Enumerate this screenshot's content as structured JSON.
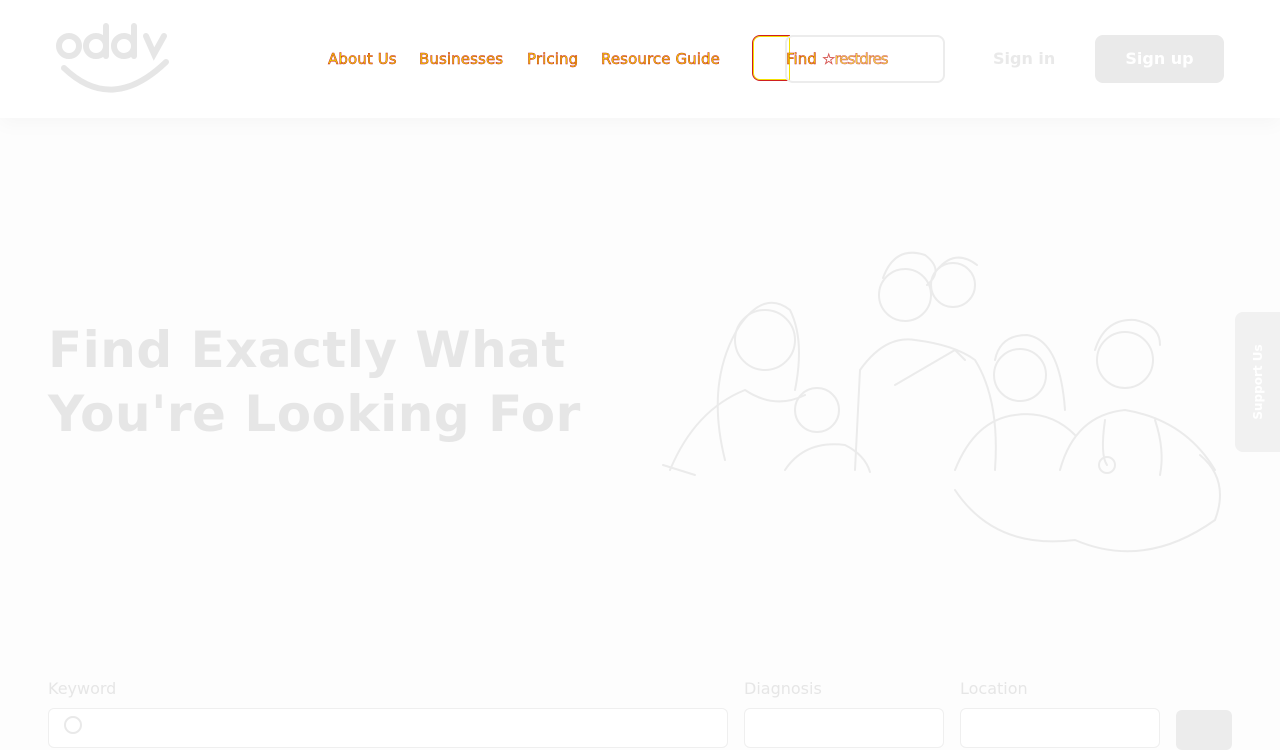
{
  "header": {
    "logo_text": "oddy",
    "nav": {
      "about": "About Us",
      "businesses": "Businesses",
      "pricing": "Pricing",
      "resource_guide": "Resource Guide"
    },
    "find_label": "Find",
    "find_ghost_text": "☆restdres",
    "sign_in": "Sign in",
    "sign_up": "Sign up"
  },
  "hero": {
    "title_line1": "Find Exactly What",
    "title_line2": "You're Looking For"
  },
  "support_tab": "Support Us",
  "search": {
    "keyword_label": "Keyword",
    "diagnosis_label": "Diagnosis",
    "location_label": "Location"
  },
  "colors": {
    "accent_yellow": "#f2e100",
    "accent_red": "#c81d1d",
    "faded_gray": "#e6e6e6"
  }
}
